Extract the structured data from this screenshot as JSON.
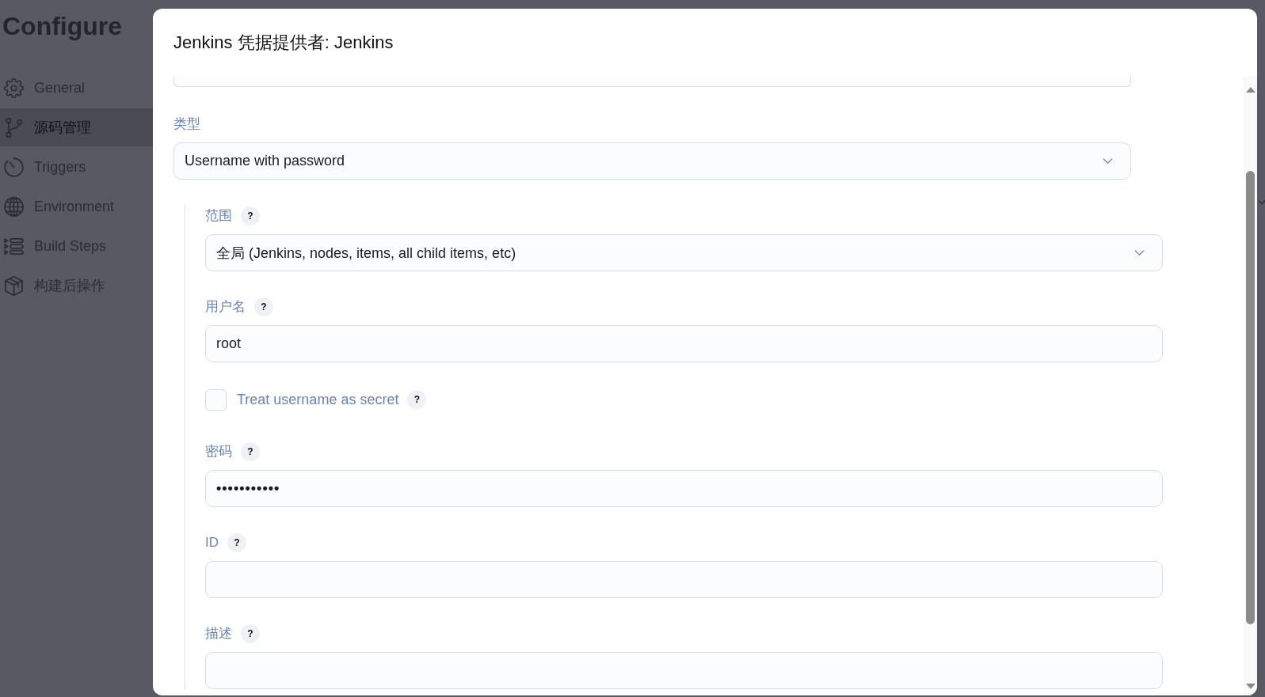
{
  "sidebar": {
    "title": "Configure",
    "items": [
      {
        "label": "General",
        "selected": false
      },
      {
        "label": "源码管理",
        "selected": true
      },
      {
        "label": "Triggers",
        "selected": false
      },
      {
        "label": "Environment",
        "selected": false
      },
      {
        "label": "Build Steps",
        "selected": false
      },
      {
        "label": "构建后操作",
        "selected": false
      }
    ]
  },
  "dialog": {
    "title": "Jenkins 凭据提供者: Jenkins",
    "type": {
      "label": "类型",
      "value": "Username with password"
    },
    "credential_fields": [
      {
        "kind": "select",
        "label": "范围",
        "help": "?",
        "value": "全局 (Jenkins, nodes, items, all child items, etc)"
      },
      {
        "kind": "text",
        "label": "用户名",
        "help": "?",
        "value": "root"
      },
      {
        "kind": "checkbox",
        "label": "Treat username as secret",
        "help": "?",
        "checked": false
      },
      {
        "kind": "password",
        "label": "密码",
        "help": "?",
        "value": "•••••••••••"
      },
      {
        "kind": "text",
        "label": "ID",
        "help": "?"
      },
      {
        "kind": "text",
        "label": "描述",
        "help": "?"
      }
    ]
  }
}
